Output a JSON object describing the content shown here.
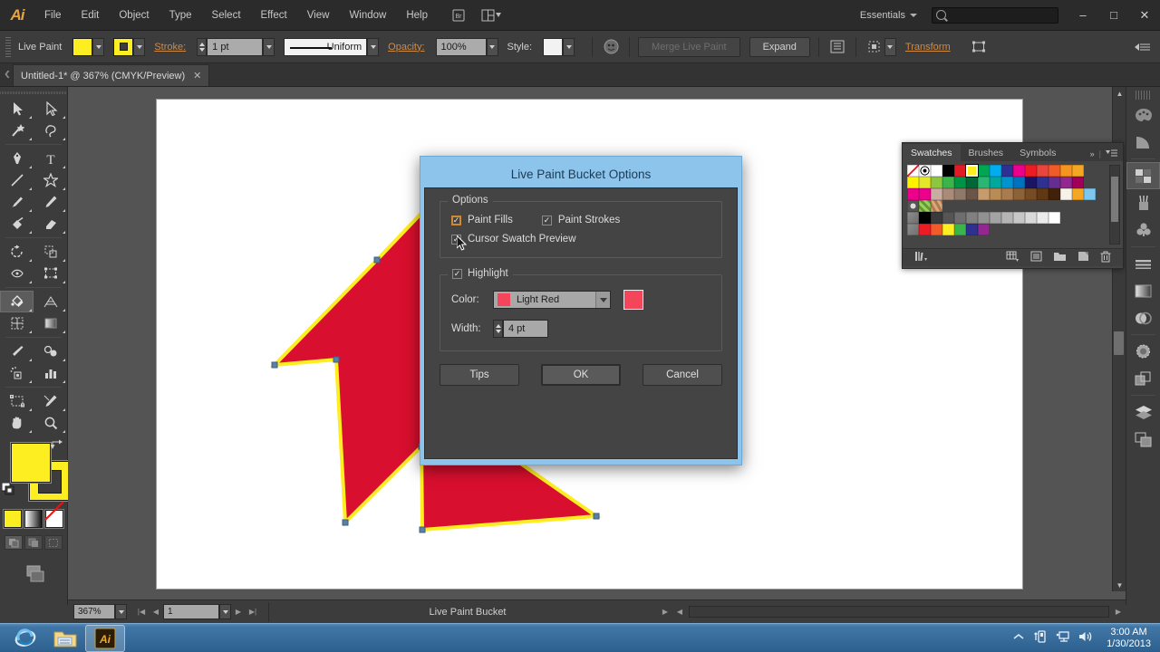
{
  "app": {
    "logo": "Ai",
    "menus": [
      "File",
      "Edit",
      "Object",
      "Type",
      "Select",
      "Effect",
      "View",
      "Window",
      "Help"
    ],
    "workspace": "Essentials",
    "search_placeholder": "",
    "window_buttons": {
      "minimize": "–",
      "maximize": "□",
      "close": "✕"
    }
  },
  "controlbar": {
    "tool_label": "Live Paint",
    "fill_color": "#fcee21",
    "stroke_color": "#fcee21",
    "stroke_label": "Stroke:",
    "stroke_weight": "1 pt",
    "profile_label": "Uniform",
    "opacity_label": "Opacity:",
    "opacity_value": "100%",
    "style_label": "Style:",
    "merge_label": "Merge Live Paint",
    "expand_label": "Expand",
    "transform_label": "Transform"
  },
  "document": {
    "tab_title": "Untitled-1* @ 367% (CMYK/Preview)",
    "tab_close": "✕"
  },
  "tools": {
    "items": [
      {
        "name": "selection-tool",
        "active": false
      },
      {
        "name": "direct-selection-tool",
        "active": false
      },
      {
        "name": "magic-wand-tool",
        "active": false
      },
      {
        "name": "lasso-tool",
        "active": false
      },
      {
        "name": "pen-tool",
        "active": false
      },
      {
        "name": "type-tool",
        "active": false
      },
      {
        "name": "line-segment-tool",
        "active": false
      },
      {
        "name": "star-tool",
        "active": false
      },
      {
        "name": "paintbrush-tool",
        "active": false
      },
      {
        "name": "pencil-tool",
        "active": false
      },
      {
        "name": "blob-brush-tool",
        "active": false
      },
      {
        "name": "eraser-tool",
        "active": false
      },
      {
        "name": "rotate-tool",
        "active": false
      },
      {
        "name": "scale-tool",
        "active": false
      },
      {
        "name": "width-tool",
        "active": false
      },
      {
        "name": "free-transform-tool",
        "active": false
      },
      {
        "name": "live-paint-bucket-tool",
        "active": true
      },
      {
        "name": "perspective-grid-tool",
        "active": false
      },
      {
        "name": "mesh-tool",
        "active": false
      },
      {
        "name": "gradient-tool",
        "active": false
      },
      {
        "name": "eyedropper-tool",
        "active": false
      },
      {
        "name": "blend-tool",
        "active": false
      },
      {
        "name": "symbol-sprayer-tool",
        "active": false
      },
      {
        "name": "column-graph-tool",
        "active": false
      },
      {
        "name": "artboard-tool",
        "active": false
      },
      {
        "name": "slice-tool",
        "active": false
      },
      {
        "name": "hand-tool",
        "active": false
      },
      {
        "name": "zoom-tool",
        "active": false
      }
    ],
    "fill_color": "#fcee21",
    "stroke_color": "#fcee21",
    "modes": [
      "color-mode",
      "gradient-mode",
      "none-mode"
    ]
  },
  "artwork": {
    "shape": "star",
    "fill": "#d80f2e",
    "stroke": "#fcee21",
    "anchor_color": "#5a7fa8"
  },
  "swatches_panel": {
    "tabs": [
      {
        "label": "Swatches",
        "active": true
      },
      {
        "label": "Brushes",
        "active": false
      },
      {
        "label": "Symbols",
        "active": false
      }
    ],
    "collapse_icon": "»",
    "menu_icon": "≡",
    "rows": [
      [
        "none",
        "registration",
        "#ffffff",
        "#000000",
        "#e01b24",
        "#fcee21",
        "#00a651",
        "#00aeef",
        "#2e3192",
        "#ec008c",
        "#ed1c24",
        "#e8453c",
        "#f15a29",
        "#f7941e",
        "#f5a623"
      ],
      [
        "#fff200",
        "#e3e829",
        "#8dc63f",
        "#39b54a",
        "#009245",
        "#006837",
        "#2bb673",
        "#00a79d",
        "#0093d0",
        "#0071bc",
        "#1b1464",
        "#2e3192",
        "#662d91",
        "#92278f",
        "#a1005a"
      ],
      [
        "#ed008c",
        "#ec008c",
        "#c9ada0",
        "#a98b78",
        "#8f7a6a",
        "#6b5548",
        "#c69c6d",
        "#b98b55",
        "#a97c50",
        "#8c6239",
        "#754c24",
        "#603813",
        "#42210b",
        "#f7f2e8",
        "#f5a623",
        "#7ec8f0"
      ],
      [
        "pattern-dots",
        "pattern-green",
        "pattern-camo"
      ],
      [
        "folder",
        "#000000",
        "#3a3a3a",
        "#555555",
        "#6e6e6e",
        "#808080",
        "#919191",
        "#a3a3a3",
        "#b5b5b5",
        "#c7c7c7",
        "#d9d9d9",
        "#ebebeb",
        "#ffffff"
      ],
      [
        "folder",
        "#ed1c24",
        "#f15a29",
        "#fcee21",
        "#39b54a",
        "#2e3192",
        "#92278f"
      ]
    ],
    "selected_swatch": "#fcee21",
    "footer_icons": [
      "swatch-libraries-icon",
      "show-swatch-kinds-icon",
      "swatch-options-icon",
      "new-color-group-icon",
      "new-swatch-icon",
      "delete-swatch-icon"
    ]
  },
  "dock": {
    "items": [
      {
        "name": "color-panel-icon",
        "active": false
      },
      {
        "name": "color-guide-panel-icon",
        "active": false
      },
      {
        "name": "swatches-panel-icon",
        "active": true
      },
      {
        "name": "brushes-panel-icon",
        "active": false
      },
      {
        "name": "symbols-panel-icon",
        "active": false
      },
      {
        "name": "stroke-panel-icon",
        "active": false
      },
      {
        "name": "gradient-panel-icon",
        "active": false
      },
      {
        "name": "transparency-panel-icon",
        "active": false
      },
      {
        "name": "appearance-panel-icon",
        "active": false
      },
      {
        "name": "graphic-styles-panel-icon",
        "active": false
      },
      {
        "name": "layers-panel-icon",
        "active": false
      },
      {
        "name": "artboards-panel-icon",
        "active": false
      }
    ]
  },
  "statusbar": {
    "zoom": "367%",
    "page": "1",
    "status_text": "Live Paint Bucket"
  },
  "dialog": {
    "title": "Live Paint Bucket Options",
    "options_group_title": "Options",
    "paint_fills": {
      "label": "Paint Fills",
      "checked": true,
      "focused": true
    },
    "paint_strokes": {
      "label": "Paint Strokes",
      "checked": true
    },
    "cursor_swatch_preview": {
      "label": "Cursor Swatch Preview",
      "checked": true
    },
    "highlight_group": {
      "label": "Highlight",
      "checked": true
    },
    "color_label": "Color:",
    "color_value": "Light Red",
    "color_hex": "#f4455a",
    "preview_hex": "#f4455a",
    "width_label": "Width:",
    "width_value": "4 pt",
    "buttons": {
      "tips": "Tips",
      "ok": "OK",
      "cancel": "Cancel"
    }
  },
  "taskbar": {
    "apps": [
      "internet-explorer-icon",
      "file-explorer-icon",
      "illustrator-icon"
    ],
    "active_app": "illustrator-icon",
    "tray_icons": [
      "show-hidden-icons",
      "usb-device-icon",
      "network-icon",
      "volume-icon"
    ],
    "time": "3:00 AM",
    "date": "1/30/2013"
  }
}
